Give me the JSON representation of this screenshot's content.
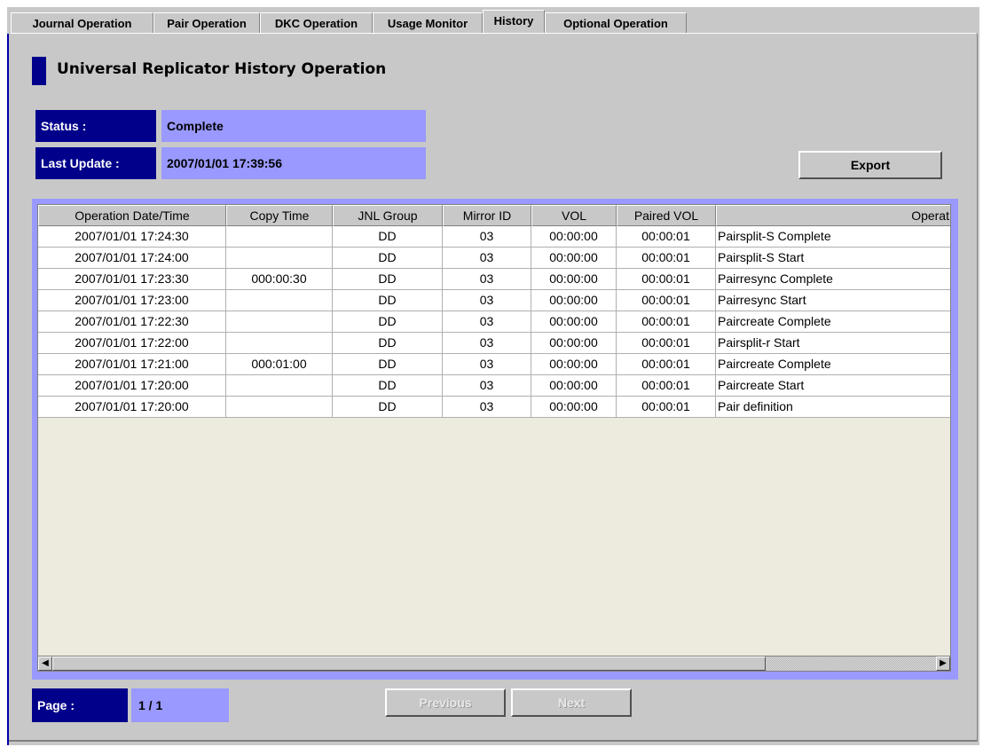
{
  "tabs": [
    {
      "label": "Journal Operation",
      "active": false
    },
    {
      "label": "Pair Operation",
      "active": false
    },
    {
      "label": "DKC Operation",
      "active": false
    },
    {
      "label": "Usage Monitor",
      "active": false
    },
    {
      "label": "History",
      "active": true
    },
    {
      "label": "Optional Operation",
      "active": false
    }
  ],
  "page_title": "Universal Replicator History Operation",
  "status": {
    "label": "Status :",
    "value": "Complete"
  },
  "last_update": {
    "label": "Last Update :",
    "value": "2007/01/01 17:39:56"
  },
  "export_label": "Export",
  "table": {
    "headers": [
      "Operation Date/Time",
      "Copy Time",
      "JNL Group",
      "Mirror ID",
      "VOL",
      "Paired VOL",
      "Operat"
    ],
    "rows": [
      [
        "2007/01/01 17:24:30",
        "",
        "DD",
        "03",
        "00:00:00",
        "00:00:01",
        "Pairsplit-S Complete"
      ],
      [
        "2007/01/01 17:24:00",
        "",
        "DD",
        "03",
        "00:00:00",
        "00:00:01",
        "Pairsplit-S Start"
      ],
      [
        "2007/01/01 17:23:30",
        "000:00:30",
        "DD",
        "03",
        "00:00:00",
        "00:00:01",
        "Pairresync Complete"
      ],
      [
        "2007/01/01 17:23:00",
        "",
        "DD",
        "03",
        "00:00:00",
        "00:00:01",
        "Pairresync Start"
      ],
      [
        "2007/01/01 17:22:30",
        "",
        "DD",
        "03",
        "00:00:00",
        "00:00:01",
        "Paircreate Complete"
      ],
      [
        "2007/01/01 17:22:00",
        "",
        "DD",
        "03",
        "00:00:00",
        "00:00:01",
        "Pairsplit-r Start"
      ],
      [
        "2007/01/01 17:21:00",
        "000:01:00",
        "DD",
        "03",
        "00:00:00",
        "00:00:01",
        "Paircreate Complete"
      ],
      [
        "2007/01/01 17:20:00",
        "",
        "DD",
        "03",
        "00:00:00",
        "00:00:01",
        "Paircreate Start"
      ],
      [
        "2007/01/01 17:20:00",
        "",
        "DD",
        "03",
        "00:00:00",
        "00:00:01",
        "Pair definition"
      ]
    ]
  },
  "page": {
    "label": "Page :",
    "value": "1 / 1"
  },
  "previous_label": "Previous",
  "next_label": "Next",
  "colors": {
    "accent": "#00008b",
    "value_bg": "#9999ff",
    "table_bg": "#ecebdd",
    "frame_bg": "#c8c8c8"
  },
  "icons": {
    "scroll_left": "left-arrow-icon",
    "scroll_right": "right-arrow-icon"
  }
}
